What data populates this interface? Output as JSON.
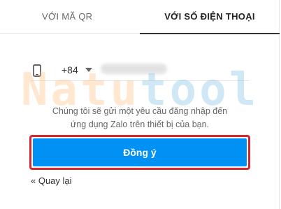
{
  "tabs": [
    {
      "label": "VỚI MÃ QR",
      "active": false
    },
    {
      "label": "VỚI SỐ ĐIỆN THOẠI",
      "active": true
    }
  ],
  "phone": {
    "icon": "mobile-phone-icon",
    "country_code": "+84",
    "value": ""
  },
  "watermark": {
    "part1": "Natu",
    "part2": "tool"
  },
  "info": {
    "line1": "Chúng tôi sẽ gửi một yêu cầu đăng nhập đến",
    "line2": "ứng dụng Zalo trên thiết bị của bạn."
  },
  "agree_button": {
    "label": "Đồng ý"
  },
  "back_link": {
    "label": "« Quay lại"
  },
  "colors": {
    "primary": "#0190f3",
    "highlight": "#d8262e"
  }
}
